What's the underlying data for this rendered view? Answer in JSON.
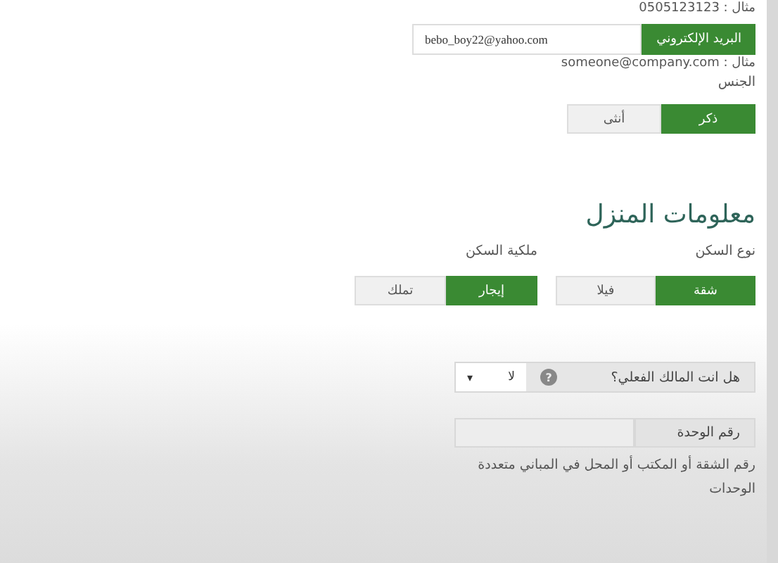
{
  "phone_hint": "مثال : 0505123123",
  "email": {
    "label": "البريد الإلكتروني",
    "value": "bebo_boy22@yahoo.com",
    "hint": "مثال : someone@company.com"
  },
  "gender": {
    "label": "الجنس",
    "options": [
      {
        "label": "ذكر",
        "selected": true
      },
      {
        "label": "أنثى",
        "selected": false
      }
    ]
  },
  "home_section": {
    "title": "معلومات المنزل",
    "groups": [
      {
        "label": "نوع السكن",
        "options": [
          {
            "label": "شقة",
            "selected": true
          },
          {
            "label": "فيلا",
            "selected": false
          }
        ]
      },
      {
        "label": "ملكية السكن",
        "options": [
          {
            "label": "إيجار",
            "selected": true
          },
          {
            "label": "تملك",
            "selected": false
          }
        ]
      }
    ],
    "owner": {
      "label": "هل انت المالك الفعلي؟",
      "help_icon": "?",
      "value": "لا",
      "caret": "▾"
    },
    "unit": {
      "label": "رقم الوحدة",
      "hint": "رقم الشقة أو المكتب أو المحل في المباني متعددة الوحدات"
    }
  }
}
